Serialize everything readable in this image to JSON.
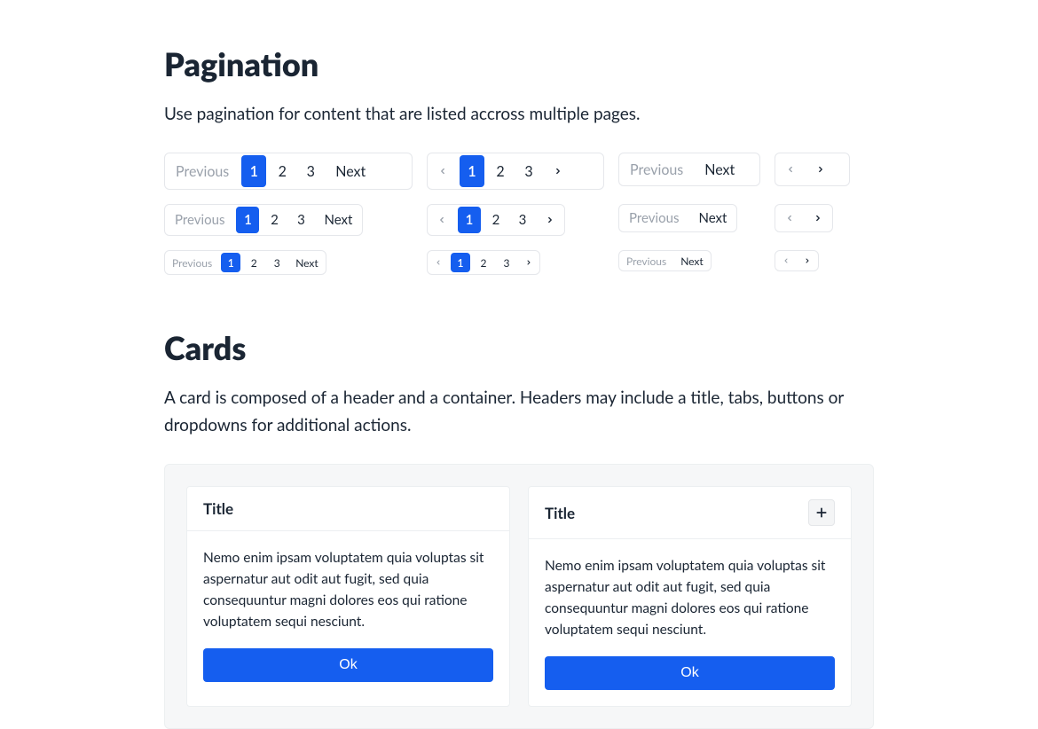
{
  "pagination": {
    "heading": "Pagination",
    "description": "Use pagination for content that are listed accross multiple pages.",
    "prev_label": "Previous",
    "next_label": "Next",
    "pages": [
      "1",
      "2",
      "3"
    ],
    "active_page": "1"
  },
  "cards": {
    "heading": "Cards",
    "description": "A card is composed of a header and a container. Headers may include a title, tabs, buttons or dropdowns for additional actions.",
    "card_title": "Title",
    "card_body": "Nemo enim ipsam voluptatem quia voluptas sit aspernatur aut odit aut fugit, sed quia consequuntur magni dolores eos qui ratione voluptatem sequi nesciunt.",
    "ok_label": "Ok"
  },
  "colors": {
    "accent": "#155eef"
  }
}
